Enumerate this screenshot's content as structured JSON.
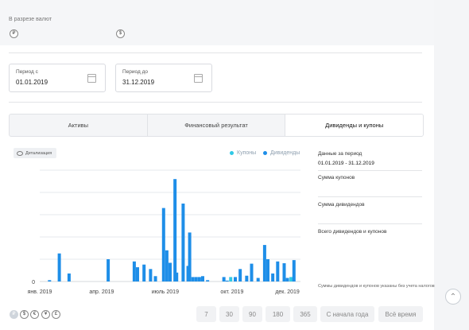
{
  "currency_section": {
    "title": "В разрезе валют",
    "icons": [
      "₽",
      "$"
    ]
  },
  "period": {
    "from_label": "Период с",
    "from_value": "01.01.2019",
    "to_label": "Период до",
    "to_value": "31.12.2019"
  },
  "tabs": [
    {
      "label": "Активы",
      "active": false
    },
    {
      "label": "Финансовый результат",
      "active": false
    },
    {
      "label": "Дивиденды и купоны",
      "active": true
    }
  ],
  "detail_button": "Детализация",
  "legend": {
    "coupons": "Купоны",
    "dividends": "Дивиденды"
  },
  "colors": {
    "coupons": "#30c9e6",
    "dividends": "#1e8ee8",
    "grid": "#e6e8ec"
  },
  "chart_data": {
    "type": "bar",
    "stacked": true,
    "x_ticks": [
      "янв. 2019",
      "апр. 2019",
      "июль 2019",
      "окт. 2019",
      "дек. 2019"
    ],
    "y_ticks": [
      "0"
    ],
    "grid": true,
    "x": [
      6,
      12,
      18,
      42,
      58,
      60,
      64,
      68,
      71,
      76,
      78,
      80,
      83,
      84,
      88,
      91,
      92,
      94,
      96,
      98,
      100,
      103,
      113,
      115,
      120,
      123,
      127,
      130,
      134,
      138,
      140,
      143,
      146,
      150,
      152,
      156
    ],
    "series": [
      {
        "name": "Купоны",
        "values": [
          0,
          0,
          0,
          0,
          0,
          0,
          0,
          0,
          0,
          0,
          0,
          0,
          0,
          0,
          0,
          0,
          0,
          0,
          0,
          0,
          0,
          0,
          0,
          1,
          0,
          0,
          0,
          0,
          0,
          0,
          0,
          0,
          0,
          0,
          1,
          0
        ]
      },
      {
        "name": "Дивиденды",
        "values": [
          0.3,
          6.3,
          1.8,
          5.0,
          4.5,
          3.2,
          3.8,
          2.8,
          1.2,
          16.5,
          7.0,
          4.2,
          23.0,
          2.0,
          17.5,
          3.5,
          11.0,
          1.0,
          1.0,
          1.0,
          1.2,
          0.3,
          1.0,
          0.2,
          1.0,
          2.8,
          1.3,
          4.0,
          0.8,
          8.2,
          5.0,
          1.8,
          4.5,
          4.1,
          0.8,
          4.8
        ]
      }
    ]
  },
  "side_panel": {
    "period_title": "Данные за период",
    "period_value": "01.01.2019 - 31.12.2019",
    "coupons_sum": "Сумма купонов",
    "dividends_sum": "Сумма дивидендов",
    "total_sum": "Всего дивидендов и купонов",
    "note": "Суммы дивидендов и купонов указаны без учета налогов"
  },
  "bottom_currencies": [
    "₽",
    "$",
    "€",
    "¥",
    "£"
  ],
  "period_buttons": [
    "7",
    "30",
    "90",
    "180",
    "365",
    "С начала года",
    "Всё время"
  ],
  "scroll_up_icon": "arrow-up-icon"
}
